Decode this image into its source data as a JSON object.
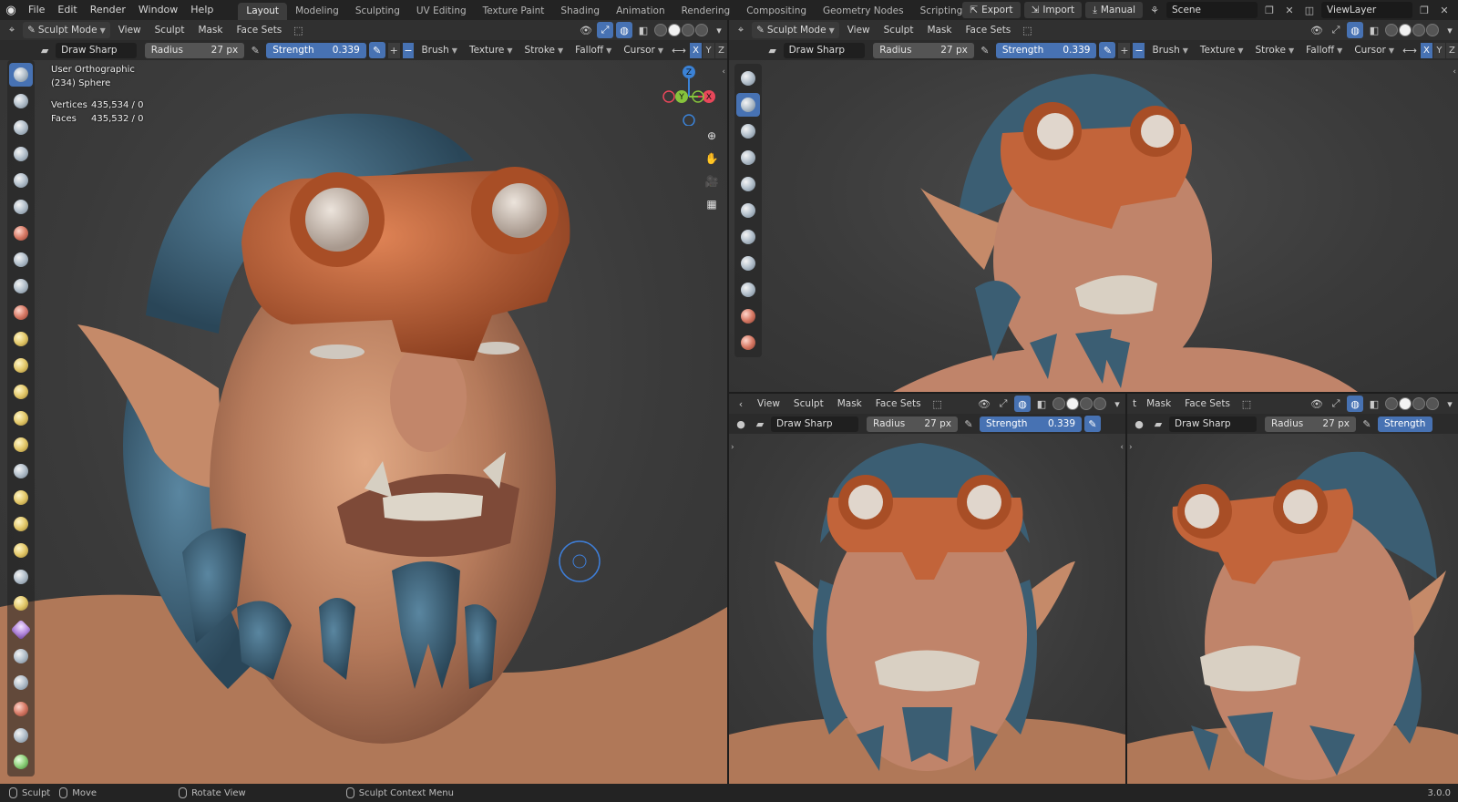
{
  "app": {
    "menus": [
      "File",
      "Edit",
      "Render",
      "Window",
      "Help"
    ],
    "workspaces": [
      {
        "label": "Layout",
        "active": true
      },
      {
        "label": "Modeling",
        "active": false
      },
      {
        "label": "Sculpting",
        "active": false
      },
      {
        "label": "UV Editing",
        "active": false
      },
      {
        "label": "Texture Paint",
        "active": false
      },
      {
        "label": "Shading",
        "active": false
      },
      {
        "label": "Animation",
        "active": false
      },
      {
        "label": "Rendering",
        "active": false
      },
      {
        "label": "Compositing",
        "active": false
      },
      {
        "label": "Geometry Nodes",
        "active": false
      },
      {
        "label": "Scripting",
        "active": false
      }
    ],
    "add_workspace": "+",
    "export_label": "Export",
    "import_label": "Import",
    "manual_label": "Manual",
    "scene_name": "Scene",
    "view_layer": "ViewLayer"
  },
  "header": {
    "mode": "Sculpt Mode",
    "view": "View",
    "sculpt": "Sculpt",
    "mask": "Mask",
    "face_sets": "Face Sets"
  },
  "tool_settings": {
    "brush_name": "Draw Sharp",
    "radius_label": "Radius",
    "radius_value": "27 px",
    "strength_label": "Strength",
    "strength_value": "0.339",
    "plus": "+",
    "minus": "−",
    "brush": "Brush",
    "texture": "Texture",
    "stroke": "Stroke",
    "falloff": "Falloff",
    "cursor": "Cursor",
    "x": "X",
    "y": "Y",
    "z": "Z"
  },
  "viewport_main": {
    "view_name": "User Orthographic",
    "object_name": "(234) Sphere",
    "vertices_label": "Vertices",
    "vertices_value": "435,534 / 0",
    "faces_label": "Faces",
    "faces_value": "435,532 / 0"
  },
  "gizmo": {
    "x": "X",
    "y": "Y",
    "z": "Z",
    "x_color": "#e8475a",
    "y_color": "#86c33c",
    "z_color": "#3b82d6"
  },
  "bottom_left_header": {
    "view": "View",
    "sculpt": "Sculpt",
    "mask": "Mask",
    "face_sets": "Face Sets"
  },
  "bottom_right_header": {
    "partial": "t",
    "mask": "Mask",
    "face_sets": "Face Sets"
  },
  "status": {
    "sculpt": "Sculpt",
    "move": "Move",
    "rotate": "Rotate View",
    "context_menu": "Sculpt Context Menu",
    "version": "3.0.0"
  },
  "colors": {
    "accent": "#4772b3",
    "skin": "#c98f6e",
    "hair": "#3b5e73",
    "goggles": "#c2643a"
  }
}
